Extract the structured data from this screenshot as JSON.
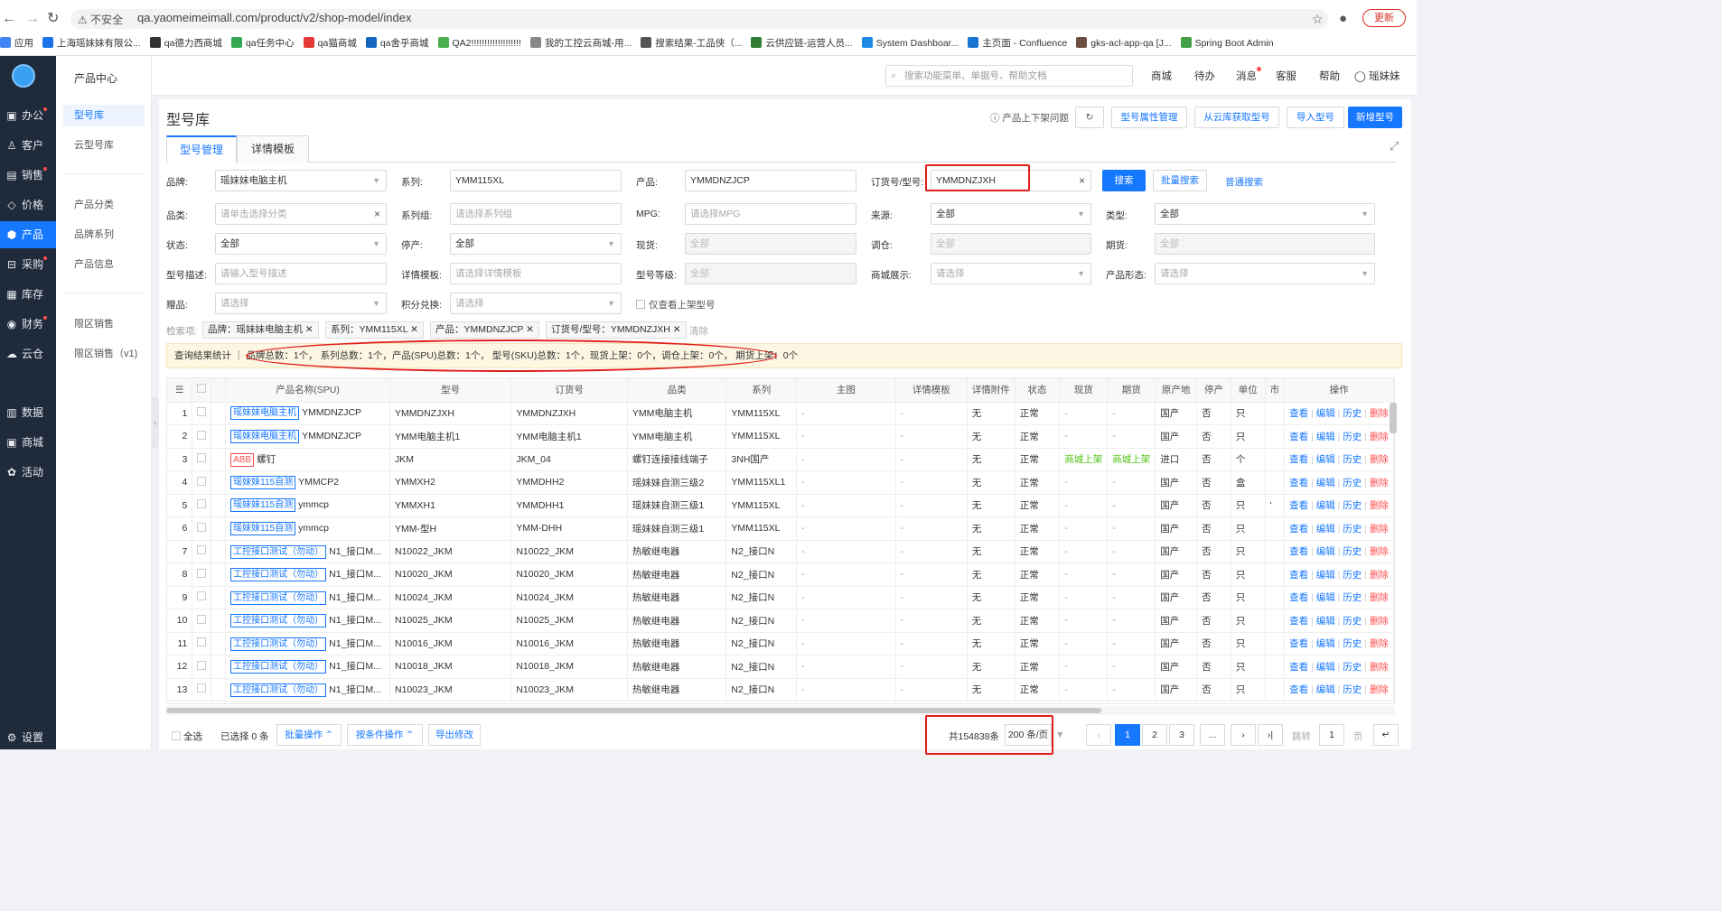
{
  "browser": {
    "insecure_label": "不安全",
    "url": "qa.yaomeimeimall.com/product/v2/shop-model/index",
    "update_label": "更新",
    "bookmarks": [
      "应用",
      "上海瑶妹妹有限公...",
      "qa德力西商城",
      "qa任务中心",
      "qa猫商城",
      "qa舍乎商城",
      "QA2!!!!!!!!!!!!!!!!!!!",
      "我的工控云商城-用...",
      "搜索结果-工品侠（...",
      "云供应链-运营人员...",
      "System Dashboar...",
      "主页面 - Confluence",
      "gks-acl-app-qa [J...",
      "Spring Boot Admin"
    ]
  },
  "sidebar": {
    "items": [
      {
        "label": "办公",
        "icon": "briefcase-icon",
        "glyph": "▣",
        "dot": true
      },
      {
        "label": "客户",
        "icon": "user-icon",
        "glyph": "♙",
        "dot": false
      },
      {
        "label": "销售",
        "icon": "doc-icon",
        "glyph": "▤",
        "dot": true
      },
      {
        "label": "价格",
        "icon": "tag-icon",
        "glyph": "◇",
        "dot": false
      },
      {
        "label": "产品",
        "icon": "cube-icon",
        "glyph": "⬢",
        "dot": false
      },
      {
        "label": "采购",
        "icon": "cart-icon",
        "glyph": "⊟",
        "dot": true
      },
      {
        "label": "库存",
        "icon": "warehouse-icon",
        "glyph": "▦",
        "dot": false
      },
      {
        "label": "财务",
        "icon": "money-icon",
        "glyph": "◉",
        "dot": true
      },
      {
        "label": "云仓",
        "icon": "cloud-icon",
        "glyph": "☁",
        "dot": false
      },
      {
        "label": "数据",
        "icon": "bar-chart-icon",
        "glyph": "▥",
        "dot": false
      },
      {
        "label": "商城",
        "icon": "shop-icon",
        "glyph": "▣",
        "dot": false
      },
      {
        "label": "活动",
        "icon": "gift-icon",
        "glyph": "✿",
        "dot": false
      }
    ],
    "settings": "设置"
  },
  "subnav": {
    "title": "产品中心",
    "items": [
      "型号库",
      "云型号库",
      "产品分类",
      "品牌系列",
      "产品信息",
      "限区销售",
      "限区销售（v1)"
    ]
  },
  "header": {
    "search_placeholder": "搜索功能菜单、单据号、帮助文档",
    "links": [
      "商城",
      "待办",
      "消息",
      "客服",
      "帮助"
    ],
    "user": "瑶妹妹"
  },
  "page": {
    "title": "型号库",
    "help_label": "产品上下架问题",
    "buttons": [
      "型号属性管理",
      "从云库获取型号",
      "导入型号",
      "新增型号"
    ],
    "tabs": [
      "型号管理",
      "详情模板"
    ]
  },
  "filters": {
    "brand": {
      "label": "品牌:",
      "value": "瑶妹妹电脑主机"
    },
    "series": {
      "label": "系列:",
      "value": "YMM115XL"
    },
    "product": {
      "label": "产品:",
      "value": "YMMDNZJCP"
    },
    "order_no": {
      "label": "订货号/型号:",
      "value": "YMMDNZJXH"
    },
    "search_btn": "搜索",
    "batch_search": "批量搜索",
    "normal_search": "普通搜索",
    "category": {
      "label": "品类:",
      "placeholder": "请单击选择分类"
    },
    "series_group": {
      "label": "系列组:",
      "placeholder": "请选择系列组"
    },
    "mpg": {
      "label": "MPG:",
      "placeholder": "请选择MPG"
    },
    "source": {
      "label": "来源:",
      "value": "全部"
    },
    "type": {
      "label": "类型:",
      "value": "全部"
    },
    "status": {
      "label": "状态:",
      "value": "全部"
    },
    "discontinued": {
      "label": "停产:",
      "value": "全部"
    },
    "stock": {
      "label": "现货:",
      "value": "全部"
    },
    "transfer": {
      "label": "调仓:",
      "value": "全部"
    },
    "futures": {
      "label": "期货:",
      "value": "全部"
    },
    "model_desc": {
      "label": "型号描述:",
      "placeholder": "请输入型号描述"
    },
    "detail_tpl": {
      "label": "详情模板:",
      "placeholder": "请选择详情模板"
    },
    "model_level": {
      "label": "型号等级:",
      "value": "全部"
    },
    "mall_display": {
      "label": "商城展示:",
      "placeholder": "请选择"
    },
    "product_form": {
      "label": "产品形态:",
      "placeholder": "请选择"
    },
    "gift": {
      "label": "赠品:",
      "placeholder": "请选择"
    },
    "points": {
      "label": "积分兑换:",
      "placeholder": "请选择"
    },
    "only_listed": "仅查看上架型号"
  },
  "chips": {
    "label": "检索项:",
    "items": [
      "品牌：瑶妹妹电脑主机",
      "系列：YMM115XL",
      "产品：YMMDNZJCP",
      "订货号/型号：YMMDNZJXH"
    ],
    "clear": "清除"
  },
  "stats": "查询结果统计 ｜ 品牌总数：1个，  系列总数：1个，产品(SPU)总数：1个，  型号(SKU)总数：1个，现货上架：0个，调仓上架：0个，  期货上架：0个",
  "table": {
    "columns": [
      "",
      "",
      "",
      "产品名称(SPU)",
      "型号",
      "订货号",
      "品类",
      "系列",
      "主图",
      "详情模板",
      "详情附件",
      "状态",
      "现货",
      "期货",
      "原产地",
      "停产",
      "单位",
      "市",
      "操作"
    ],
    "ops": [
      "查看",
      "编辑",
      "历史",
      "删除"
    ],
    "rows": [
      {
        "n": "1",
        "tag": "瑶妹妹电脑主机",
        "tagred": false,
        "name": "YMMDNZJCP",
        "model": "YMMDNZJXH",
        "order": "YMMDNZJXH",
        "cat": "YMM电脑主机",
        "series": "YMM115XL",
        "img": "-",
        "tpl": "-",
        "att": "无",
        "status": "正常",
        "stock": "-",
        "fut": "-",
        "origin": "国产",
        "disc": "否",
        "unit": "只",
        "mkt": ""
      },
      {
        "n": "2",
        "tag": "瑶妹妹电脑主机",
        "tagred": false,
        "name": "YMMDNZJCP",
        "model": "YMM电脑主机1",
        "order": "YMM电脑主机1",
        "cat": "YMM电脑主机",
        "series": "YMM115XL",
        "img": "-",
        "tpl": "-",
        "att": "无",
        "status": "正常",
        "stock": "-",
        "fut": "-",
        "origin": "国产",
        "disc": "否",
        "unit": "只",
        "mkt": ""
      },
      {
        "n": "3",
        "tag": "ABB",
        "tagred": true,
        "name": "螺钉",
        "model": "JKM",
        "order": "JKM_04",
        "cat": "螺钉连接接线端子",
        "series": "3NH国产",
        "img": "-",
        "tpl": "-",
        "att": "无",
        "status": "正常",
        "stock": "商城上架",
        "fut": "商城上架",
        "origin": "进口",
        "disc": "否",
        "unit": "个",
        "mkt": ""
      },
      {
        "n": "4",
        "tag": "瑶妹妹115自测",
        "tagred": false,
        "name": "YMMCP2",
        "model": "YMMXH2",
        "order": "YMMDHH2",
        "cat": "瑶妹妹自测三级2",
        "series": "YMM115XL1",
        "img": "-",
        "tpl": "-",
        "att": "无",
        "status": "正常",
        "stock": "-",
        "fut": "-",
        "origin": "国产",
        "disc": "否",
        "unit": "盒",
        "mkt": ""
      },
      {
        "n": "5",
        "tag": "瑶妹妹115自测",
        "tagred": false,
        "name": "ymmcp",
        "model": "YMMXH1",
        "order": "YMMDHH1",
        "cat": "瑶妹妹自测三级1",
        "series": "YMM115XL",
        "img": "-",
        "tpl": "-",
        "att": "无",
        "status": "正常",
        "stock": "-",
        "fut": "-",
        "origin": "国产",
        "disc": "否",
        "unit": "只",
        "mkt": "'"
      },
      {
        "n": "6",
        "tag": "瑶妹妹115自测",
        "tagred": false,
        "name": "ymmcp",
        "model": "YMM-型H",
        "order": "YMM-DHH",
        "cat": "瑶妹妹自测三级1",
        "series": "YMM115XL",
        "img": "-",
        "tpl": "-",
        "att": "无",
        "status": "正常",
        "stock": "-",
        "fut": "-",
        "origin": "国产",
        "disc": "否",
        "unit": "只",
        "mkt": ""
      },
      {
        "n": "7",
        "tag": "工控接口测试（勿动）",
        "tagred": false,
        "name": "N1_接口M...",
        "model": "N10022_JKM",
        "order": "N10022_JKM",
        "cat": "热敏继电器",
        "series": "N2_接口N",
        "img": "-",
        "tpl": "-",
        "att": "无",
        "status": "正常",
        "stock": "-",
        "fut": "-",
        "origin": "国产",
        "disc": "否",
        "unit": "只",
        "mkt": ""
      },
      {
        "n": "8",
        "tag": "工控接口测试（勿动）",
        "tagred": false,
        "name": "N1_接口M...",
        "model": "N10020_JKM",
        "order": "N10020_JKM",
        "cat": "热敏继电器",
        "series": "N2_接口N",
        "img": "-",
        "tpl": "-",
        "att": "无",
        "status": "正常",
        "stock": "-",
        "fut": "-",
        "origin": "国产",
        "disc": "否",
        "unit": "只",
        "mkt": ""
      },
      {
        "n": "9",
        "tag": "工控接口测试（勿动）",
        "tagred": false,
        "name": "N1_接口M...",
        "model": "N10024_JKM",
        "order": "N10024_JKM",
        "cat": "热敏继电器",
        "series": "N2_接口N",
        "img": "-",
        "tpl": "-",
        "att": "无",
        "status": "正常",
        "stock": "-",
        "fut": "-",
        "origin": "国产",
        "disc": "否",
        "unit": "只",
        "mkt": ""
      },
      {
        "n": "10",
        "tag": "工控接口测试（勿动）",
        "tagred": false,
        "name": "N1_接口M...",
        "model": "N10025_JKM",
        "order": "N10025_JKM",
        "cat": "热敏继电器",
        "series": "N2_接口N",
        "img": "-",
        "tpl": "-",
        "att": "无",
        "status": "正常",
        "stock": "-",
        "fut": "-",
        "origin": "国产",
        "disc": "否",
        "unit": "只",
        "mkt": ""
      },
      {
        "n": "11",
        "tag": "工控接口测试（勿动）",
        "tagred": false,
        "name": "N1_接口M...",
        "model": "N10016_JKM",
        "order": "N10016_JKM",
        "cat": "热敏继电器",
        "series": "N2_接口N",
        "img": "-",
        "tpl": "-",
        "att": "无",
        "status": "正常",
        "stock": "-",
        "fut": "-",
        "origin": "国产",
        "disc": "否",
        "unit": "只",
        "mkt": ""
      },
      {
        "n": "12",
        "tag": "工控接口测试（勿动）",
        "tagred": false,
        "name": "N1_接口M...",
        "model": "N10018_JKM",
        "order": "N10018_JKM",
        "cat": "热敏继电器",
        "series": "N2_接口N",
        "img": "-",
        "tpl": "-",
        "att": "无",
        "status": "正常",
        "stock": "-",
        "fut": "-",
        "origin": "国产",
        "disc": "否",
        "unit": "只",
        "mkt": ""
      },
      {
        "n": "13",
        "tag": "工控接口测试（勿动）",
        "tagred": false,
        "name": "N1_接口M...",
        "model": "N10023_JKM",
        "order": "N10023_JKM",
        "cat": "热敏继电器",
        "series": "N2_接口N",
        "img": "-",
        "tpl": "-",
        "att": "无",
        "status": "正常",
        "stock": "-",
        "fut": "-",
        "origin": "国产",
        "disc": "否",
        "unit": "只",
        "mkt": ""
      }
    ]
  },
  "footer": {
    "select_all": "全选",
    "selected": "已选择 0 条",
    "batch_op": "批量操作",
    "cond_op": "按条件操作",
    "export": "导出修改",
    "total": "共154838条",
    "page_size": "200 条/页",
    "pages": [
      "1",
      "2",
      "3",
      "..."
    ],
    "goto_label": "跳转",
    "goto_value": "1",
    "page_unit": "页"
  },
  "colors": {
    "primary": "#1677ff",
    "sidebar": "#1f2a3a",
    "highlight": "#e0201c",
    "stats_bg": "#fdf6e3"
  }
}
